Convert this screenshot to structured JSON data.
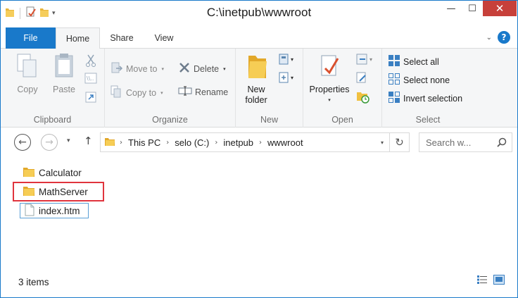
{
  "window": {
    "title": "C:\\inetpub\\wwwroot",
    "controls": {
      "minimize": "—",
      "maximize": "☐",
      "close": "✕"
    }
  },
  "ribbon_tabs": {
    "file": "File",
    "home": "Home",
    "share": "Share",
    "view": "View"
  },
  "clipboard": {
    "copy": "Copy",
    "paste": "Paste",
    "label": "Clipboard"
  },
  "organize": {
    "move_to": "Move to",
    "copy_to": "Copy to",
    "delete": "Delete",
    "rename": "Rename",
    "label": "Organize"
  },
  "new": {
    "new_folder_line1": "New",
    "new_folder_line2": "folder",
    "label": "New"
  },
  "open": {
    "properties": "Properties",
    "label": "Open"
  },
  "select": {
    "select_all": "Select all",
    "select_none": "Select none",
    "invert_selection": "Invert selection",
    "label": "Select"
  },
  "address": {
    "crumbs": [
      "This PC",
      "selo (C:)",
      "inetpub",
      "wwwroot"
    ]
  },
  "search": {
    "placeholder": "Search w..."
  },
  "files": [
    {
      "name": "Calculator",
      "type": "folder"
    },
    {
      "name": "MathServer",
      "type": "folder"
    },
    {
      "name": "index.htm",
      "type": "file"
    }
  ],
  "status": {
    "count": "3 items"
  },
  "colors": {
    "accent": "#1979ca",
    "close": "#c7403a",
    "highlight_red": "#e0343d",
    "highlight_blue": "#5a9fd6",
    "folder": "#f0c040"
  }
}
